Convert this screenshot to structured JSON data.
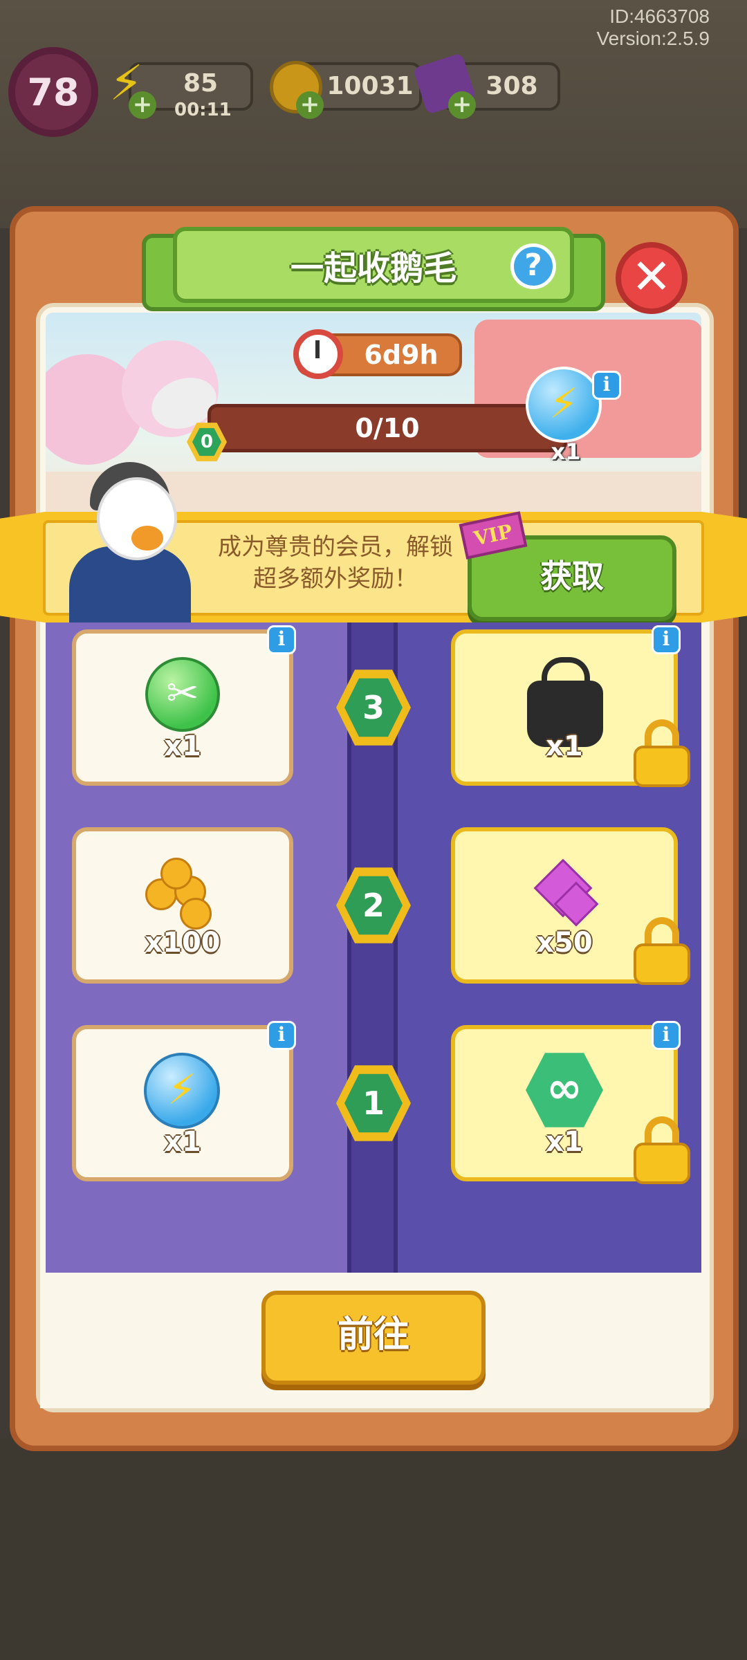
{
  "debug": {
    "id": "ID:4663708",
    "version": "Version:2.5.9"
  },
  "hud": {
    "level": "78",
    "energy": {
      "value": "85",
      "timer": "00:11",
      "icon": "lightning-icon",
      "color": "#f2d21a"
    },
    "coins": {
      "value": "10031",
      "icon": "coin-icon",
      "color": "#e9b218"
    },
    "gems": {
      "value": "308",
      "icon": "gem-icon",
      "color": "#8f4fb8"
    }
  },
  "dialog": {
    "title": "一起收鹅毛",
    "help_label": "?",
    "close_label": "✕",
    "timer": "6d9h",
    "progress": "0/10",
    "current_level": "0",
    "progress_reward": {
      "icon": "energy-orb-icon",
      "qty": "x1"
    },
    "vip": {
      "tag": "VIP",
      "message": "成为尊贵的会员，解锁超多额外奖励！",
      "button_label": "获取"
    },
    "tiers": [
      {
        "level": "3",
        "free": {
          "icon": "scissors-icon",
          "qty": "x1",
          "info": true
        },
        "vip": {
          "icon": "bag-icon",
          "qty": "x1",
          "info": true,
          "locked": true
        }
      },
      {
        "level": "2",
        "free": {
          "icon": "coins-pile-icon",
          "qty": "x100",
          "info": false
        },
        "vip": {
          "icon": "gems-icon",
          "qty": "x50",
          "info": false,
          "locked": true
        }
      },
      {
        "level": "1",
        "free": {
          "icon": "energy-orb-icon",
          "qty": "x1",
          "info": true
        },
        "vip": {
          "icon": "infinity-hex-icon",
          "qty": "x1",
          "info": true,
          "locked": true
        }
      }
    ],
    "go_button_label": "前往"
  },
  "colors": {
    "panel": "#d3834a",
    "title_green": "#a8dc62",
    "vip_yellow": "#f7c325",
    "track_purple": "#6e5fb5",
    "go_button": "#f6c12a"
  }
}
